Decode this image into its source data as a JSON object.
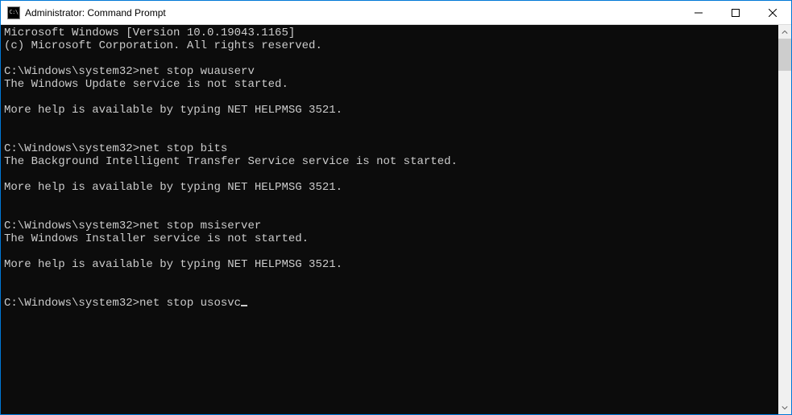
{
  "window": {
    "title": "Administrator: Command Prompt",
    "icon_label": "C:\\"
  },
  "console": {
    "lines": [
      "Microsoft Windows [Version 10.0.19043.1165]",
      "(c) Microsoft Corporation. All rights reserved.",
      "",
      "C:\\Windows\\system32>net stop wuauserv",
      "The Windows Update service is not started.",
      "",
      "More help is available by typing NET HELPMSG 3521.",
      "",
      "",
      "C:\\Windows\\system32>net stop bits",
      "The Background Intelligent Transfer Service service is not started.",
      "",
      "More help is available by typing NET HELPMSG 3521.",
      "",
      "",
      "C:\\Windows\\system32>net stop msiserver",
      "The Windows Installer service is not started.",
      "",
      "More help is available by typing NET HELPMSG 3521.",
      "",
      "",
      "C:\\Windows\\system32>net stop usosvc"
    ],
    "current_prompt": "C:\\Windows\\system32>",
    "current_input": "net stop usosvc"
  }
}
